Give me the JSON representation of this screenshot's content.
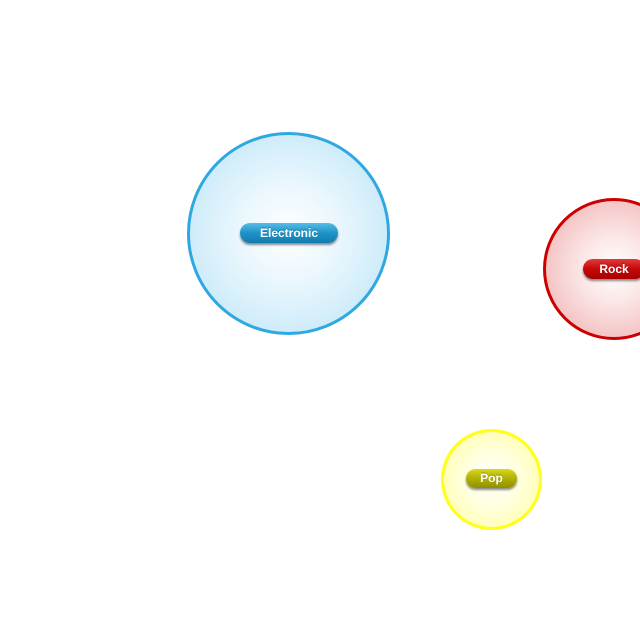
{
  "bubbles": [
    {
      "id": "electronic",
      "label": "Electronic",
      "color": "#2ea8e0"
    },
    {
      "id": "rock",
      "label": "Rock",
      "color": "#cc0000"
    },
    {
      "id": "pop",
      "label": "Pop",
      "color": "#ffff1a"
    }
  ]
}
